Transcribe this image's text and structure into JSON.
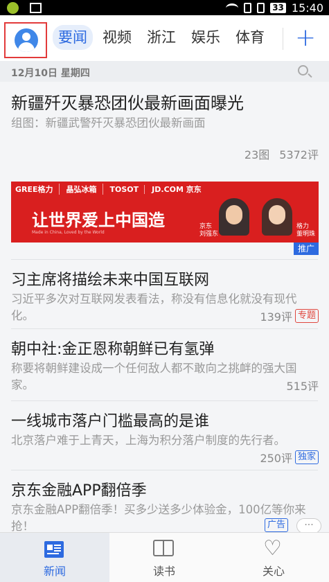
{
  "status_bar": {
    "battery": "33",
    "time": "15:40"
  },
  "top_nav": {
    "tabs": [
      {
        "label": "要闻",
        "active": true
      },
      {
        "label": "视频"
      },
      {
        "label": "浙江"
      },
      {
        "label": "娱乐"
      },
      {
        "label": "体育"
      }
    ],
    "add_label": "+"
  },
  "date_bar": {
    "date": "12月10日 星期四"
  },
  "feed": {
    "featured": {
      "title": "新疆歼灭暴恐团伙最新画面曝光",
      "desc": "组图：新疆武警歼灭暴恐团伙最新画面",
      "images": "23图",
      "comments": "5372评"
    },
    "ad": {
      "brands": [
        "GREE格力",
        "晶弘冰箱",
        "TOSOT",
        "JD.COM 京东"
      ],
      "slogan": "让世界爱上中国造",
      "tagline": "Made in China, Loved by the World",
      "person1_company": "京东",
      "person1_name": "刘强东",
      "person2_company": "格力",
      "person2_name": "董明珠",
      "label": "推广"
    },
    "items": [
      {
        "title": "习主席将描绘未来中国互联网",
        "desc": "习近平多次对互联网发表看法，称没有信息化就没有现代化。",
        "comments": "139评",
        "badge": "专题"
      },
      {
        "title": "朝中社:金正恩称朝鲜已有氢弹",
        "desc": "称要将朝鲜建设成一个任何敌人都不敢向之挑衅的强大国家。",
        "comments": "515评"
      },
      {
        "title": "一线城市落户门槛最高的是谁",
        "desc": "北京落户难于上青天，上海为积分落户制度的先行者。",
        "comments": "250评",
        "badge": "独家"
      },
      {
        "title": "京东金融APP翻倍季",
        "desc": "京东金融APP翻倍季！买多少送多少体验金，100亿等你来抢！",
        "badge": "广告",
        "more": "···"
      }
    ]
  },
  "bottom_nav": {
    "items": [
      {
        "label": "新闻",
        "active": true
      },
      {
        "label": "读书"
      },
      {
        "label": "关心"
      }
    ]
  },
  "colors": {
    "accent": "#2d6ae0",
    "highlight_border": "#e23a3a",
    "ad_red": "#d91f1f"
  }
}
